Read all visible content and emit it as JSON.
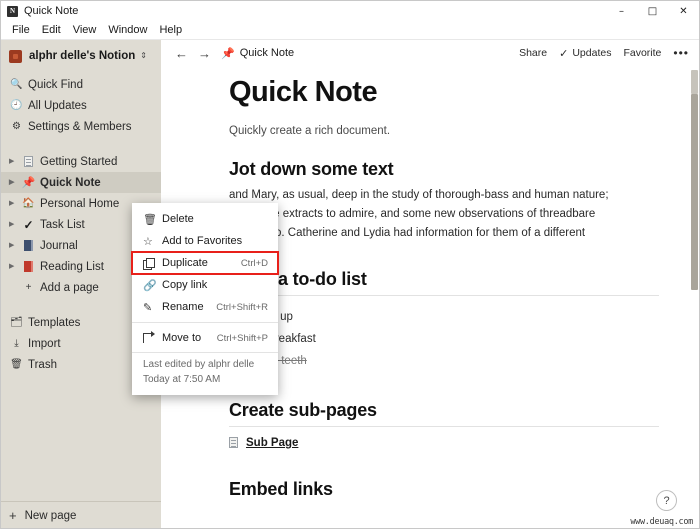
{
  "window": {
    "title": "Quick Note",
    "app_icon": "notion-icon",
    "minimize": "–",
    "maximize": "□",
    "close": "✕"
  },
  "menubar": {
    "items": [
      "File",
      "Edit",
      "View",
      "Window",
      "Help"
    ]
  },
  "sidebar": {
    "workspace": {
      "name": "alphr delle's Notion",
      "chevron": "⌃⌄"
    },
    "quick_items": [
      {
        "label": "Quick Find",
        "icon": "search-icon"
      },
      {
        "label": "All Updates",
        "icon": "clock-icon"
      },
      {
        "label": "Settings & Members",
        "icon": "gear-icon"
      }
    ],
    "pages": [
      {
        "label": "Getting Started",
        "icon": "document-icon",
        "selected": false
      },
      {
        "label": "Quick Note",
        "icon": "pin-icon",
        "selected": true
      },
      {
        "label": "Personal Home",
        "icon": "house-icon",
        "selected": false
      },
      {
        "label": "Task List",
        "icon": "check-icon",
        "selected": false
      },
      {
        "label": "Journal",
        "icon": "blue-book-icon",
        "selected": false
      },
      {
        "label": "Reading List",
        "icon": "red-book-icon",
        "selected": false
      }
    ],
    "add_page": {
      "label": "Add a page",
      "icon": "plus-icon"
    },
    "utilities": [
      {
        "label": "Templates",
        "icon": "templates-icon"
      },
      {
        "label": "Import",
        "icon": "import-icon"
      },
      {
        "label": "Trash",
        "icon": "trash-icon"
      }
    ],
    "new_page": {
      "label": "New page",
      "icon": "plus-icon"
    }
  },
  "topbar": {
    "back": "←",
    "forward": "→",
    "breadcrumb_icon": "pin-icon",
    "breadcrumb": "Quick Note",
    "share": "Share",
    "updates": "Updates",
    "updates_icon": "check-icon",
    "favorite": "Favorite",
    "more": "•••"
  },
  "page": {
    "title": "Quick Note",
    "subtitle": "Quickly create a rich document.",
    "heading_text": "Jot down some text",
    "paragraph_lines": [
      "and Mary, as usual, deep in the study of thorough-bass and human nature;",
      "had some extracts to admire, and some new observations of threadbare",
      "to listen to. Catherine and Lydia had information for them of a different"
    ],
    "todo_heading": "Make a to-do list",
    "todos": [
      {
        "label": "Wake up",
        "checked": false
      },
      {
        "label": "Eat breakfast",
        "checked": false
      },
      {
        "label": "Brush teeth",
        "checked": true
      }
    ],
    "subpage_heading": "Create sub-pages",
    "subpage_label": "Sub Page",
    "embed_heading": "Embed links"
  },
  "context_menu": {
    "items": [
      {
        "label": "Delete",
        "shortcut": "",
        "icon": "trash-icon",
        "highlighted": false
      },
      {
        "label": "Add to Favorites",
        "shortcut": "",
        "icon": "star-icon",
        "highlighted": false
      },
      {
        "label": "Duplicate",
        "shortcut": "Ctrl+D",
        "icon": "duplicate-icon",
        "highlighted": true
      },
      {
        "label": "Copy link",
        "shortcut": "",
        "icon": "link-icon",
        "highlighted": false
      },
      {
        "label": "Rename",
        "shortcut": "Ctrl+Shift+R",
        "icon": "rename-icon",
        "highlighted": false
      }
    ],
    "move_to": {
      "label": "Move to",
      "shortcut": "Ctrl+Shift+P",
      "icon": "move-to-icon"
    },
    "footer": {
      "edited_by": "Last edited by alphr delle",
      "edited_at": "Today at 7:50 AM"
    },
    "highlight_color": "#e8201a"
  },
  "overlays": {
    "help_label": "?",
    "watermark": "www.deuaq.com"
  }
}
